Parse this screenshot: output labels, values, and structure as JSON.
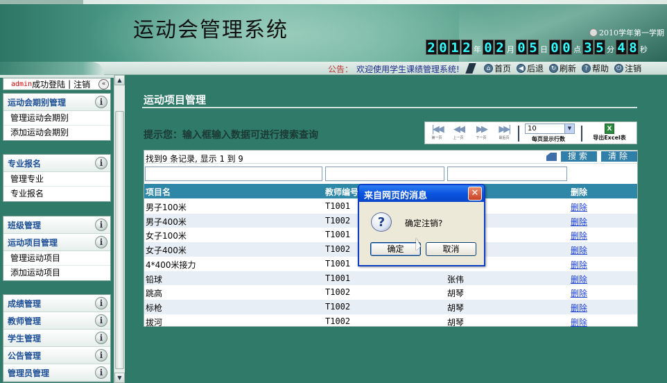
{
  "header": {
    "system_title": "运动会管理系统",
    "term": "2010学年第一学期",
    "clock": {
      "year": "2012",
      "month": "02",
      "day": "05",
      "hour": "00",
      "minute": "35",
      "second": "48",
      "units": [
        "年",
        "月",
        "日",
        "点",
        "分",
        "秒"
      ]
    }
  },
  "noticebar": {
    "label": "公告：",
    "text": "欢迎使用学生课绩管理系统!",
    "links": [
      {
        "label": "首页",
        "icon": "home-icon"
      },
      {
        "label": "后退",
        "icon": "back-icon"
      },
      {
        "label": "刷新",
        "icon": "refresh-icon"
      },
      {
        "label": "帮助",
        "icon": "help-icon"
      },
      {
        "label": "注销",
        "icon": "power-icon"
      }
    ]
  },
  "sidebar": {
    "login": {
      "user": "admin",
      "status": "成功登陆",
      "sep": "|",
      "logout": "注销"
    },
    "groups": [
      {
        "title": "运动会期别管理",
        "items": [
          "管理运动会期别",
          "添加运动会期别"
        ]
      },
      {
        "title": "专业报名",
        "items": [
          "管理专业",
          "专业报名"
        ]
      },
      {
        "title": "班级管理",
        "items": []
      },
      {
        "title": "运动项目管理",
        "items": [
          "管理运动项目",
          "添加运动项目"
        ]
      },
      {
        "title": "成绩管理",
        "items": []
      },
      {
        "title": "教师管理",
        "items": []
      },
      {
        "title": "学生管理",
        "items": []
      },
      {
        "title": "公告管理",
        "items": []
      },
      {
        "title": "管理员管理",
        "items": []
      }
    ]
  },
  "main": {
    "page_title": "运动项目管理",
    "hint": "提示您：输入框输入数据可进行搜索查询",
    "pager": {
      "buttons": [
        {
          "glyph": "|◀◀",
          "label": "第一页"
        },
        {
          "glyph": "◀◀",
          "label": "上一页"
        },
        {
          "glyph": "▶▶",
          "label": "下一页"
        },
        {
          "glyph": "▶▶|",
          "label": "最后页"
        }
      ],
      "page_size": "10",
      "page_size_label": "每页显示行数",
      "export_label": "导出Excel表"
    },
    "grid": {
      "info_prefix": "找到",
      "info_count": "9",
      "info_mid": "条记录, 显示",
      "info_from": "1",
      "info_to_word": "到",
      "info_to": "9",
      "search_label": "搜索",
      "clear_label": "清除",
      "columns": [
        "项目名",
        "教师编号",
        "",
        "删除"
      ],
      "rows": [
        {
          "name": "男子100米",
          "teacher_id": "T1001",
          "teacher": "",
          "action": "删除"
        },
        {
          "name": "男子400米",
          "teacher_id": "T1002",
          "teacher": "",
          "action": "删除"
        },
        {
          "name": "女子100米",
          "teacher_id": "T1001",
          "teacher": "",
          "action": "删除"
        },
        {
          "name": "女子400米",
          "teacher_id": "T1002",
          "teacher": "",
          "action": "删除"
        },
        {
          "name": "4*400米接力",
          "teacher_id": "T1001",
          "teacher": "",
          "action": "删除"
        },
        {
          "name": "铅球",
          "teacher_id": "T1001",
          "teacher": "张伟",
          "action": "删除"
        },
        {
          "name": "跳高",
          "teacher_id": "T1002",
          "teacher": "胡琴",
          "action": "删除"
        },
        {
          "name": "标枪",
          "teacher_id": "T1002",
          "teacher": "胡琴",
          "action": "删除"
        },
        {
          "name": "拔河",
          "teacher_id": "T1002",
          "teacher": "胡琴",
          "action": "删除"
        }
      ]
    }
  },
  "dialog": {
    "title": "来自网页的消息",
    "message": "确定注销?",
    "ok": "确定",
    "cancel": "取消"
  }
}
